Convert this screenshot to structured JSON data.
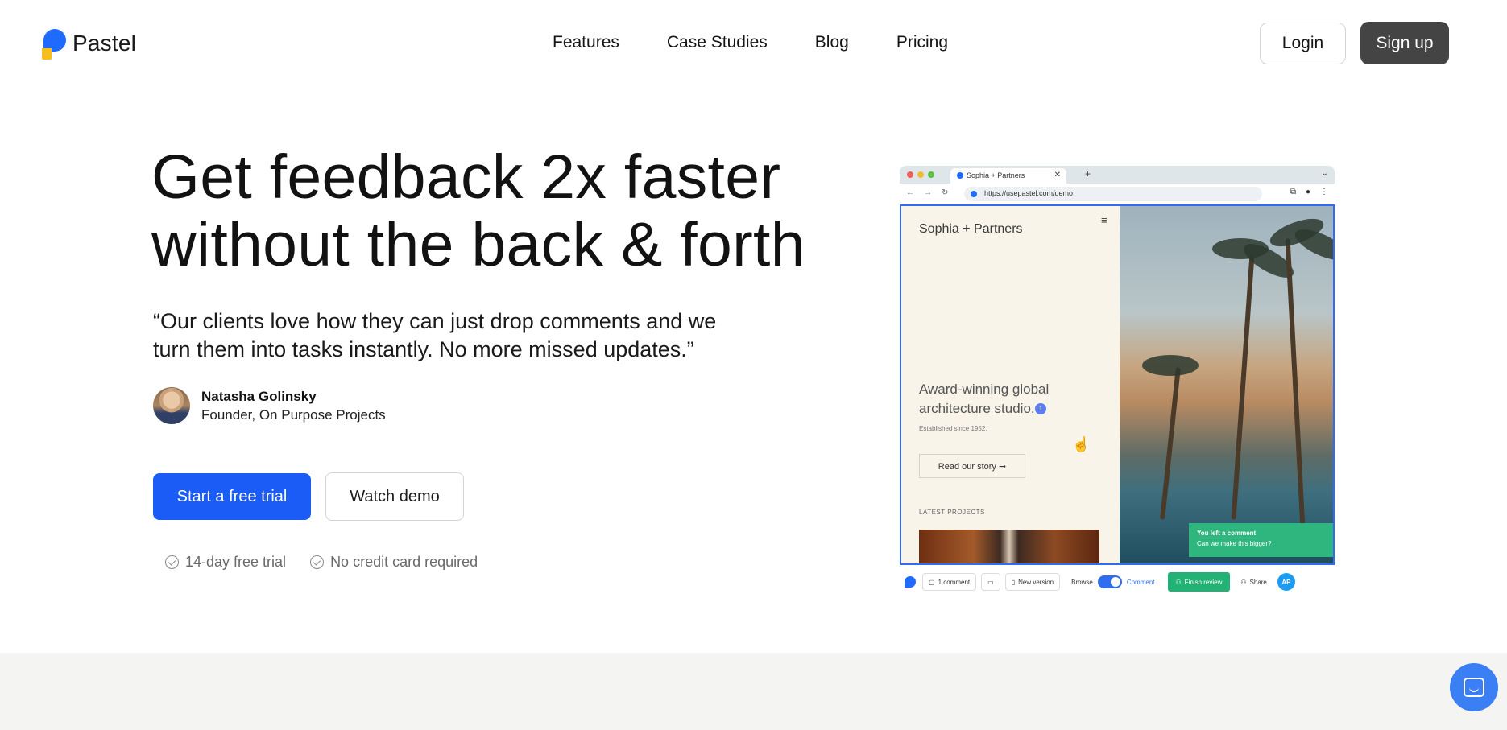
{
  "brand": {
    "name": "Pastel"
  },
  "nav": {
    "items": [
      "Features",
      "Case Studies",
      "Blog",
      "Pricing"
    ]
  },
  "auth": {
    "login_label": "Login",
    "signup_label": "Sign up"
  },
  "hero": {
    "headline_line1": "Get feedback 2x faster",
    "headline_line2": "without the back & forth",
    "quote_line1": "“Our clients love how they can just drop comments and we",
    "quote_line2": "turn them into tasks instantly. No more missed updates.”",
    "author_name": "Natasha Golinsky",
    "author_title": "Founder, On Purpose Projects",
    "cta_primary": "Start a free trial",
    "cta_secondary": "Watch demo",
    "perks": [
      "14-day free trial",
      "No credit card required"
    ]
  },
  "mock": {
    "tab_title": "Sophia + Partners",
    "url": "https://usepastel.com/demo",
    "site_brand": "Sophia + Partners",
    "site_heading": "Award-winning global architecture studio.",
    "badge": "1",
    "site_sub": "Established since 1952.",
    "story_button": "Read our story ➞",
    "latest_label": "LATEST PROJECTS",
    "toast_title": "You left a comment",
    "toast_text": "Can we make this bigger?",
    "comment_count": "1 comment",
    "new_version": "New version",
    "browse_label": "Browse",
    "comment_label": "Comment",
    "finish_label": "Finish review",
    "share_label": "Share",
    "avatar_initials": "AP"
  },
  "colors": {
    "primary": "#1a5cf5",
    "dark_button": "#444444",
    "success": "#22b276",
    "band": "#f4f4f2"
  },
  "icons": [
    "logo-icon",
    "check-icon",
    "chat-icon",
    "menu-icon",
    "cursor-icon"
  ]
}
